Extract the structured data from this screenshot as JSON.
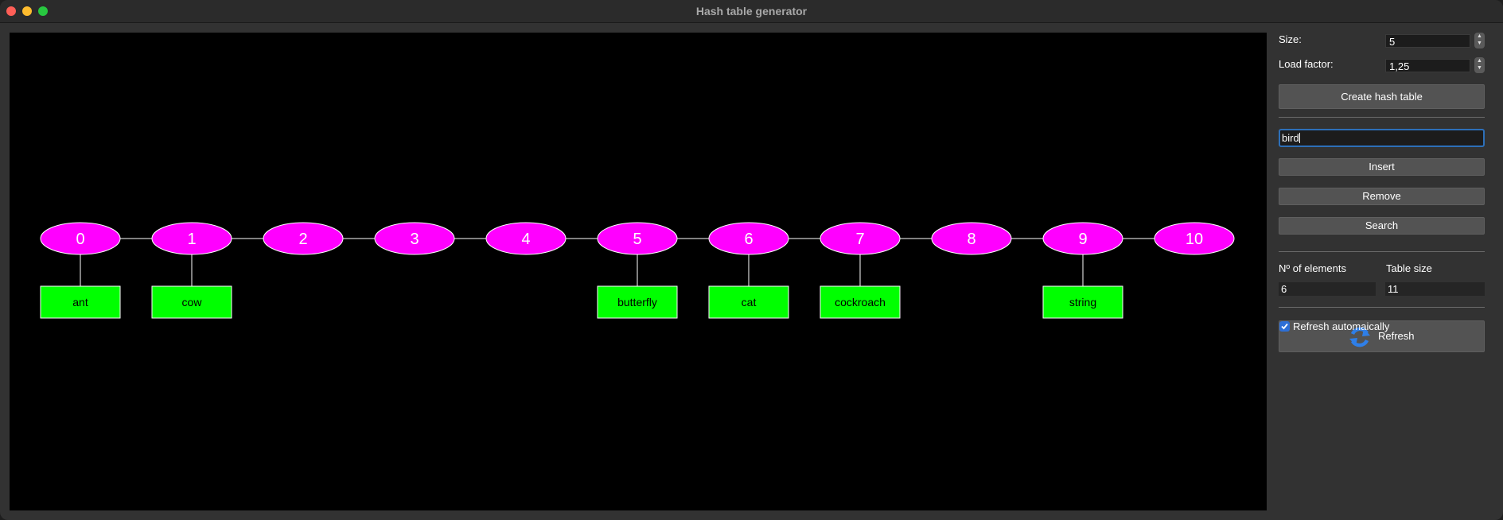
{
  "window": {
    "title": "Hash table generator"
  },
  "canvas": {
    "buckets": [
      "0",
      "1",
      "2",
      "3",
      "4",
      "5",
      "6",
      "7",
      "8",
      "9",
      "10"
    ],
    "entries": [
      {
        "bucket": 0,
        "value": "ant"
      },
      {
        "bucket": 1,
        "value": "cow"
      },
      {
        "bucket": 5,
        "value": "butterfly"
      },
      {
        "bucket": 6,
        "value": "cat"
      },
      {
        "bucket": 7,
        "value": "cockroach"
      },
      {
        "bucket": 9,
        "value": "string"
      }
    ],
    "colors": {
      "bucket": "#ff00ff",
      "entry": "#00ff00",
      "background": "#000000",
      "line": "#ffffff"
    }
  },
  "panel": {
    "size_label": "Size:",
    "size_value": "5",
    "load_factor_label": "Load factor:",
    "load_factor_value": "1,25",
    "create_button": "Create hash table",
    "key_input": "bird",
    "insert_button": "Insert",
    "remove_button": "Remove",
    "search_button": "Search",
    "elements_label": "Nº of elements",
    "elements_value": "6",
    "table_size_label": "Table size",
    "table_size_value": "11",
    "refresh_button": "Refresh",
    "refresh_icon": "refresh-icon",
    "auto_refresh_label": "Refresh automaically",
    "auto_refresh_checked": true
  }
}
